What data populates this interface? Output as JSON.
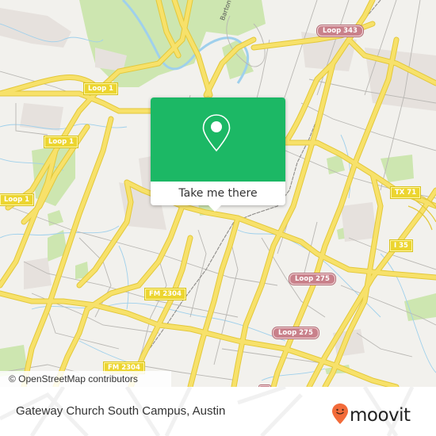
{
  "map": {
    "attribution": "© OpenStreetMap contributors",
    "street_labels": [
      {
        "name": "Barton Creek",
        "display": "Barton Cr"
      }
    ],
    "shields": [
      {
        "label": "Loop 1",
        "style": "yellow"
      },
      {
        "label": "Loop 1",
        "style": "yellow"
      },
      {
        "label": "Loop 1",
        "style": "yellow"
      },
      {
        "label": "Loop 343",
        "style": "red"
      },
      {
        "label": "TX 71",
        "style": "yellow"
      },
      {
        "label": "I 35",
        "style": "yellow"
      },
      {
        "label": "Loop 275",
        "style": "red"
      },
      {
        "label": "Loop 275",
        "style": "red"
      },
      {
        "label": "FM 2304",
        "style": "yellow"
      },
      {
        "label": "FM 2304",
        "style": "yellow"
      }
    ],
    "colors": {
      "background": "#f2f1ed",
      "park": "#cde6b0",
      "water": "#9fd0ec",
      "highway": "#f3dc55",
      "minor_road": "#b4b2ae"
    }
  },
  "popup": {
    "icon": "location-pin-icon",
    "button_label": "Take me there",
    "accent_color": "#1cb865"
  },
  "footer": {
    "place_name": "Gateway Church South Campus, Austin",
    "brand": "moovit",
    "brand_icon": "moovit-smiley-pin-icon",
    "brand_color": "#f26b3a"
  }
}
